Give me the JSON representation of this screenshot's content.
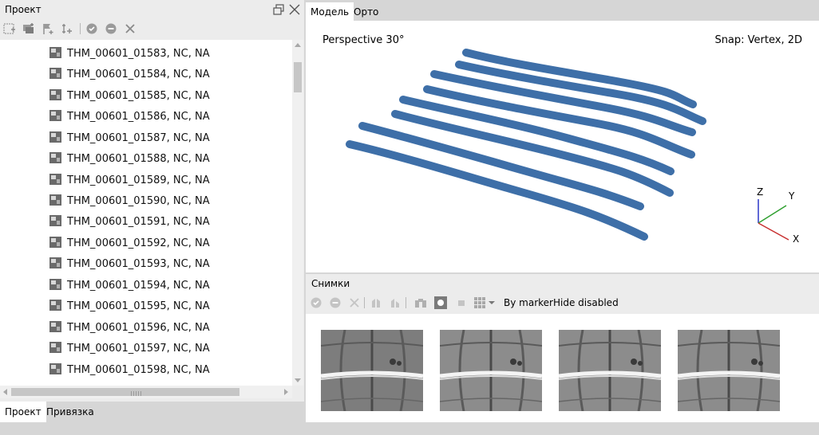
{
  "project_panel": {
    "title": "Проект",
    "tree_items": [
      "THM_00601_01583, NC, NA",
      "THM_00601_01584, NC, NA",
      "THM_00601_01585, NC, NA",
      "THM_00601_01586, NC, NA",
      "THM_00601_01587, NC, NA",
      "THM_00601_01588, NC, NA",
      "THM_00601_01589, NC, NA",
      "THM_00601_01590, NC, NA",
      "THM_00601_01591, NC, NA",
      "THM_00601_01592, NC, NA",
      "THM_00601_01593, NC, NA",
      "THM_00601_01594, NC, NA",
      "THM_00601_01595, NC, NA",
      "THM_00601_01596, NC, NA",
      "THM_00601_01597, NC, NA",
      "THM_00601_01598, NC, NA"
    ],
    "bottom_tabs": [
      {
        "label": "Проект",
        "active": true
      },
      {
        "label": "Привязка",
        "active": false
      }
    ],
    "toolbar_icons": [
      "add-chunk-icon",
      "add-photos-icon",
      "add-marker-icon",
      "add-scalebar-icon",
      "enable-icon",
      "disable-icon",
      "remove-icon"
    ]
  },
  "model_view": {
    "tabs": [
      {
        "label": "Модель",
        "active": true
      },
      {
        "label": "Орто",
        "active": false
      }
    ],
    "perspective_label": "Perspective 30°",
    "snap_label": "Snap: Vertex, 2D",
    "axis_labels": {
      "z": "Z",
      "y": "Y",
      "x": "X"
    },
    "track_color": "#3e6fa8"
  },
  "photos_panel": {
    "title": "Снимки",
    "by_marker_label": "By marker",
    "hide_disabled_label": "Hide disabled",
    "thumbnail_count": 4
  }
}
